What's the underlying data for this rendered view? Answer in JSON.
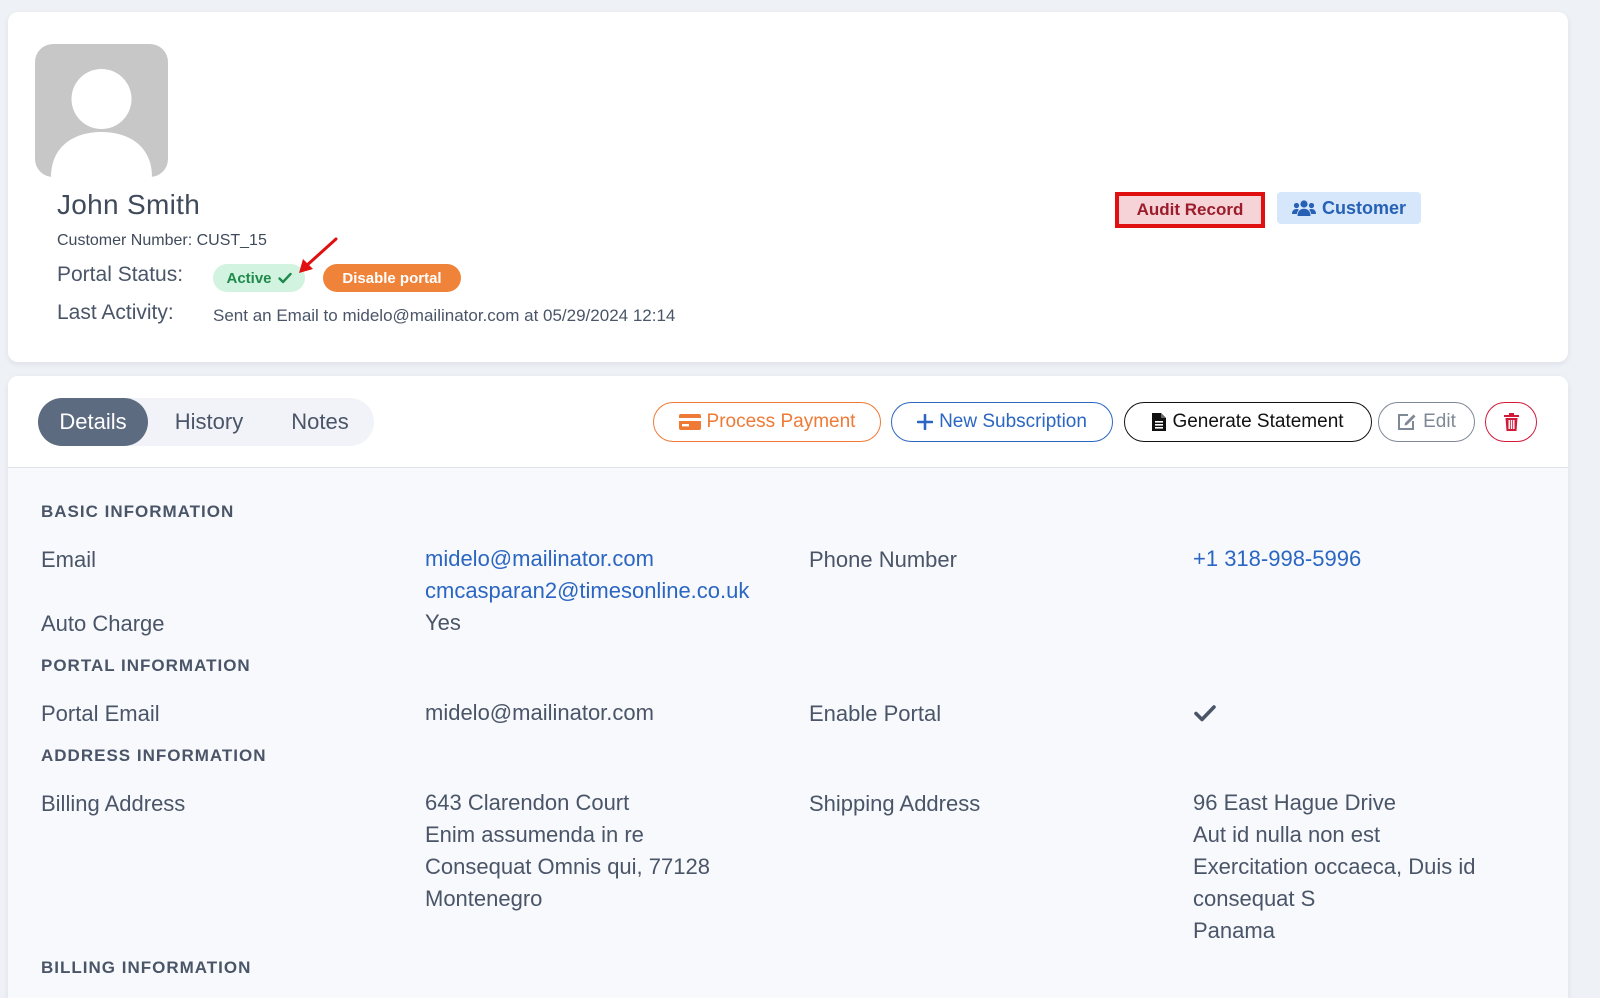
{
  "profile": {
    "name": "John Smith",
    "customer_number": "Customer Number: CUST_15",
    "portal_status_label": "Portal Status:",
    "portal_status_value": "Active",
    "disable_portal_label": "Disable portal",
    "last_activity_label": "Last Activity:",
    "last_activity_text": "Sent an Email to midelo@mailinator.com at 05/29/2024 12:14",
    "audit_record_label": "Audit Record",
    "customer_badge_label": "Customer"
  },
  "tabs": [
    {
      "label": "Details",
      "active": true
    },
    {
      "label": "History",
      "active": false
    },
    {
      "label": "Notes",
      "active": false
    }
  ],
  "actions": {
    "process_payment": "Process Payment",
    "new_subscription": "New Subscription",
    "generate_statement": "Generate Statement",
    "edit": "Edit"
  },
  "sections": {
    "basic": {
      "title": "BASIC INFORMATION",
      "email_label": "Email",
      "email_primary": "midelo@mailinator.com",
      "email_secondary": "cmcasparan2@timesonline.co.uk",
      "phone_label": "Phone Number",
      "phone_value": "+1 318-998-5996",
      "auto_charge_label": "Auto Charge",
      "auto_charge_value": "Yes"
    },
    "portal": {
      "title": "PORTAL INFORMATION",
      "portal_email_label": "Portal Email",
      "portal_email_value": "midelo@mailinator.com",
      "enable_portal_label": "Enable Portal"
    },
    "address": {
      "title": "ADDRESS INFORMATION",
      "billing_label": "Billing Address",
      "billing_lines": [
        "643 Clarendon Court",
        "Enim assumenda in re",
        "Consequat Omnis qui, 77128",
        "Montenegro"
      ],
      "shipping_label": "Shipping Address",
      "shipping_lines": [
        "96 East Hague Drive",
        "Aut id nulla non est",
        "Exercitation occaeca, Duis id",
        "consequat S",
        "Panama"
      ]
    },
    "billing": {
      "title": "BILLING INFORMATION"
    }
  },
  "colors": {
    "accent_blue": "#2b66c2",
    "orange": "#ee7a36",
    "success_green": "#1f8a4c",
    "danger_red": "#d11a3a",
    "highlight_red": "#e01010"
  },
  "icons": {
    "avatar": "user-silhouette-icon",
    "active": "check-icon",
    "customer": "users-icon",
    "process_payment": "credit-card-icon",
    "new_subscription": "plus-icon",
    "generate_statement": "document-icon",
    "edit": "edit-icon",
    "delete": "trash-icon",
    "enable_portal": "check-icon"
  }
}
